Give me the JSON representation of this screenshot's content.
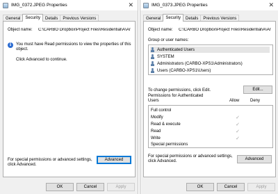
{
  "left_window": {
    "title": "IMG_0372.JPEG Properties",
    "tabs": [
      "General",
      "Security",
      "Details",
      "Previous Versions"
    ],
    "object_name_label": "Object name:",
    "object_name_value": "C:\\CARBO Dropbox\\Project Files\\Residential\\A\\Ar",
    "info_message": "You must have Read permissions to view the properties of this object.",
    "info_advanced": "Click Advanced to continue.",
    "special_text": "For special permissions or advanced settings, click Advanced.",
    "advanced_button": "Advanced",
    "ok_button": "OK",
    "cancel_button": "Cancel",
    "apply_button": "Apply"
  },
  "right_window": {
    "title": "IMG_0373.JPEG Properties",
    "tabs": [
      "General",
      "Security",
      "Details",
      "Previous Versions"
    ],
    "object_name_label": "Object name:",
    "object_name_value": "C:\\CARBO Dropbox\\Project Files\\Residential\\A\\Ar",
    "group_label": "Group or user names:",
    "groups": [
      "Authenticated Users",
      "SYSTEM",
      "Administrators (CARBO-XPS1\\Administrators)",
      "Users (CARBO-XPS1\\Users)"
    ],
    "change_text": "To change permissions, click Edit.",
    "edit_button": "Edit...",
    "perm_for": "Permissions for Authenticated",
    "perm_users": "Users",
    "allow_label": "Allow",
    "deny_label": "Deny",
    "permissions": [
      {
        "name": "Full control",
        "allow": ""
      },
      {
        "name": "Modify",
        "allow": "✓"
      },
      {
        "name": "Read & execute",
        "allow": "✓"
      },
      {
        "name": "Read",
        "allow": "✓"
      },
      {
        "name": "Write",
        "allow": "✓"
      },
      {
        "name": "Special permissions",
        "allow": ""
      }
    ],
    "special_text": "For special permissions or advanced settings, click Advanced.",
    "advanced_button": "Advanced",
    "ok_button": "OK",
    "cancel_button": "Cancel",
    "apply_button": "Apply"
  },
  "icons": {
    "close": "close-icon",
    "info": "info-icon",
    "user": "user-group-icon"
  },
  "colors": {
    "focus": "#0078d7",
    "info": "#2a6bd1",
    "selection": "#e5e5e5"
  }
}
